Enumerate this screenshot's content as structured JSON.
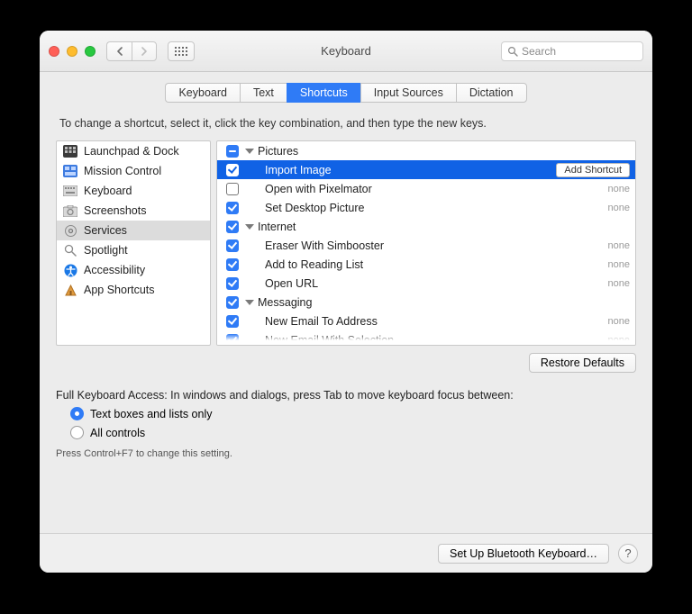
{
  "window": {
    "title": "Keyboard"
  },
  "search": {
    "placeholder": "Search"
  },
  "tabs": [
    {
      "label": "Keyboard",
      "selected": false
    },
    {
      "label": "Text",
      "selected": false
    },
    {
      "label": "Shortcuts",
      "selected": true
    },
    {
      "label": "Input Sources",
      "selected": false
    },
    {
      "label": "Dictation",
      "selected": false
    }
  ],
  "instruction": "To change a shortcut, select it, click the key combination, and then type the new keys.",
  "sidebar": {
    "items": [
      {
        "label": "Launchpad & Dock",
        "icon": "launchpad"
      },
      {
        "label": "Mission Control",
        "icon": "mission"
      },
      {
        "label": "Keyboard",
        "icon": "keyboard"
      },
      {
        "label": "Screenshots",
        "icon": "screenshots"
      },
      {
        "label": "Services",
        "icon": "gear",
        "selected": true
      },
      {
        "label": "Spotlight",
        "icon": "spotlight"
      },
      {
        "label": "Accessibility",
        "icon": "accessibility"
      },
      {
        "label": "App Shortcuts",
        "icon": "appshortcuts"
      }
    ]
  },
  "tree": [
    {
      "type": "group",
      "label": "Pictures",
      "check": "mixed"
    },
    {
      "type": "item",
      "label": "Import Image",
      "check": "on",
      "selected": true,
      "shortcut_button": "Add Shortcut"
    },
    {
      "type": "item",
      "label": "Open with Pixelmator",
      "check": "off",
      "shortcut": "none"
    },
    {
      "type": "item",
      "label": "Set Desktop Picture",
      "check": "on",
      "shortcut": "none"
    },
    {
      "type": "group",
      "label": "Internet",
      "check": "on"
    },
    {
      "type": "item",
      "label": "Eraser With Simbooster",
      "check": "on",
      "shortcut": "none"
    },
    {
      "type": "item",
      "label": "Add to Reading List",
      "check": "on",
      "shortcut": "none"
    },
    {
      "type": "item",
      "label": "Open URL",
      "check": "on",
      "shortcut": "none"
    },
    {
      "type": "group",
      "label": "Messaging",
      "check": "on"
    },
    {
      "type": "item",
      "label": "New Email To Address",
      "check": "on",
      "shortcut": "none"
    },
    {
      "type": "item",
      "label": "New Email With Selection",
      "check": "on",
      "shortcut": "none"
    }
  ],
  "restore_label": "Restore Defaults",
  "fka": {
    "heading": "Full Keyboard Access: In windows and dialogs, press Tab to move keyboard focus between:",
    "options": [
      {
        "label": "Text boxes and lists only",
        "selected": true
      },
      {
        "label": "All controls",
        "selected": false
      }
    ],
    "hint": "Press Control+F7 to change this setting."
  },
  "footer": {
    "setup_bt": "Set Up Bluetooth Keyboard…",
    "help": "?"
  }
}
